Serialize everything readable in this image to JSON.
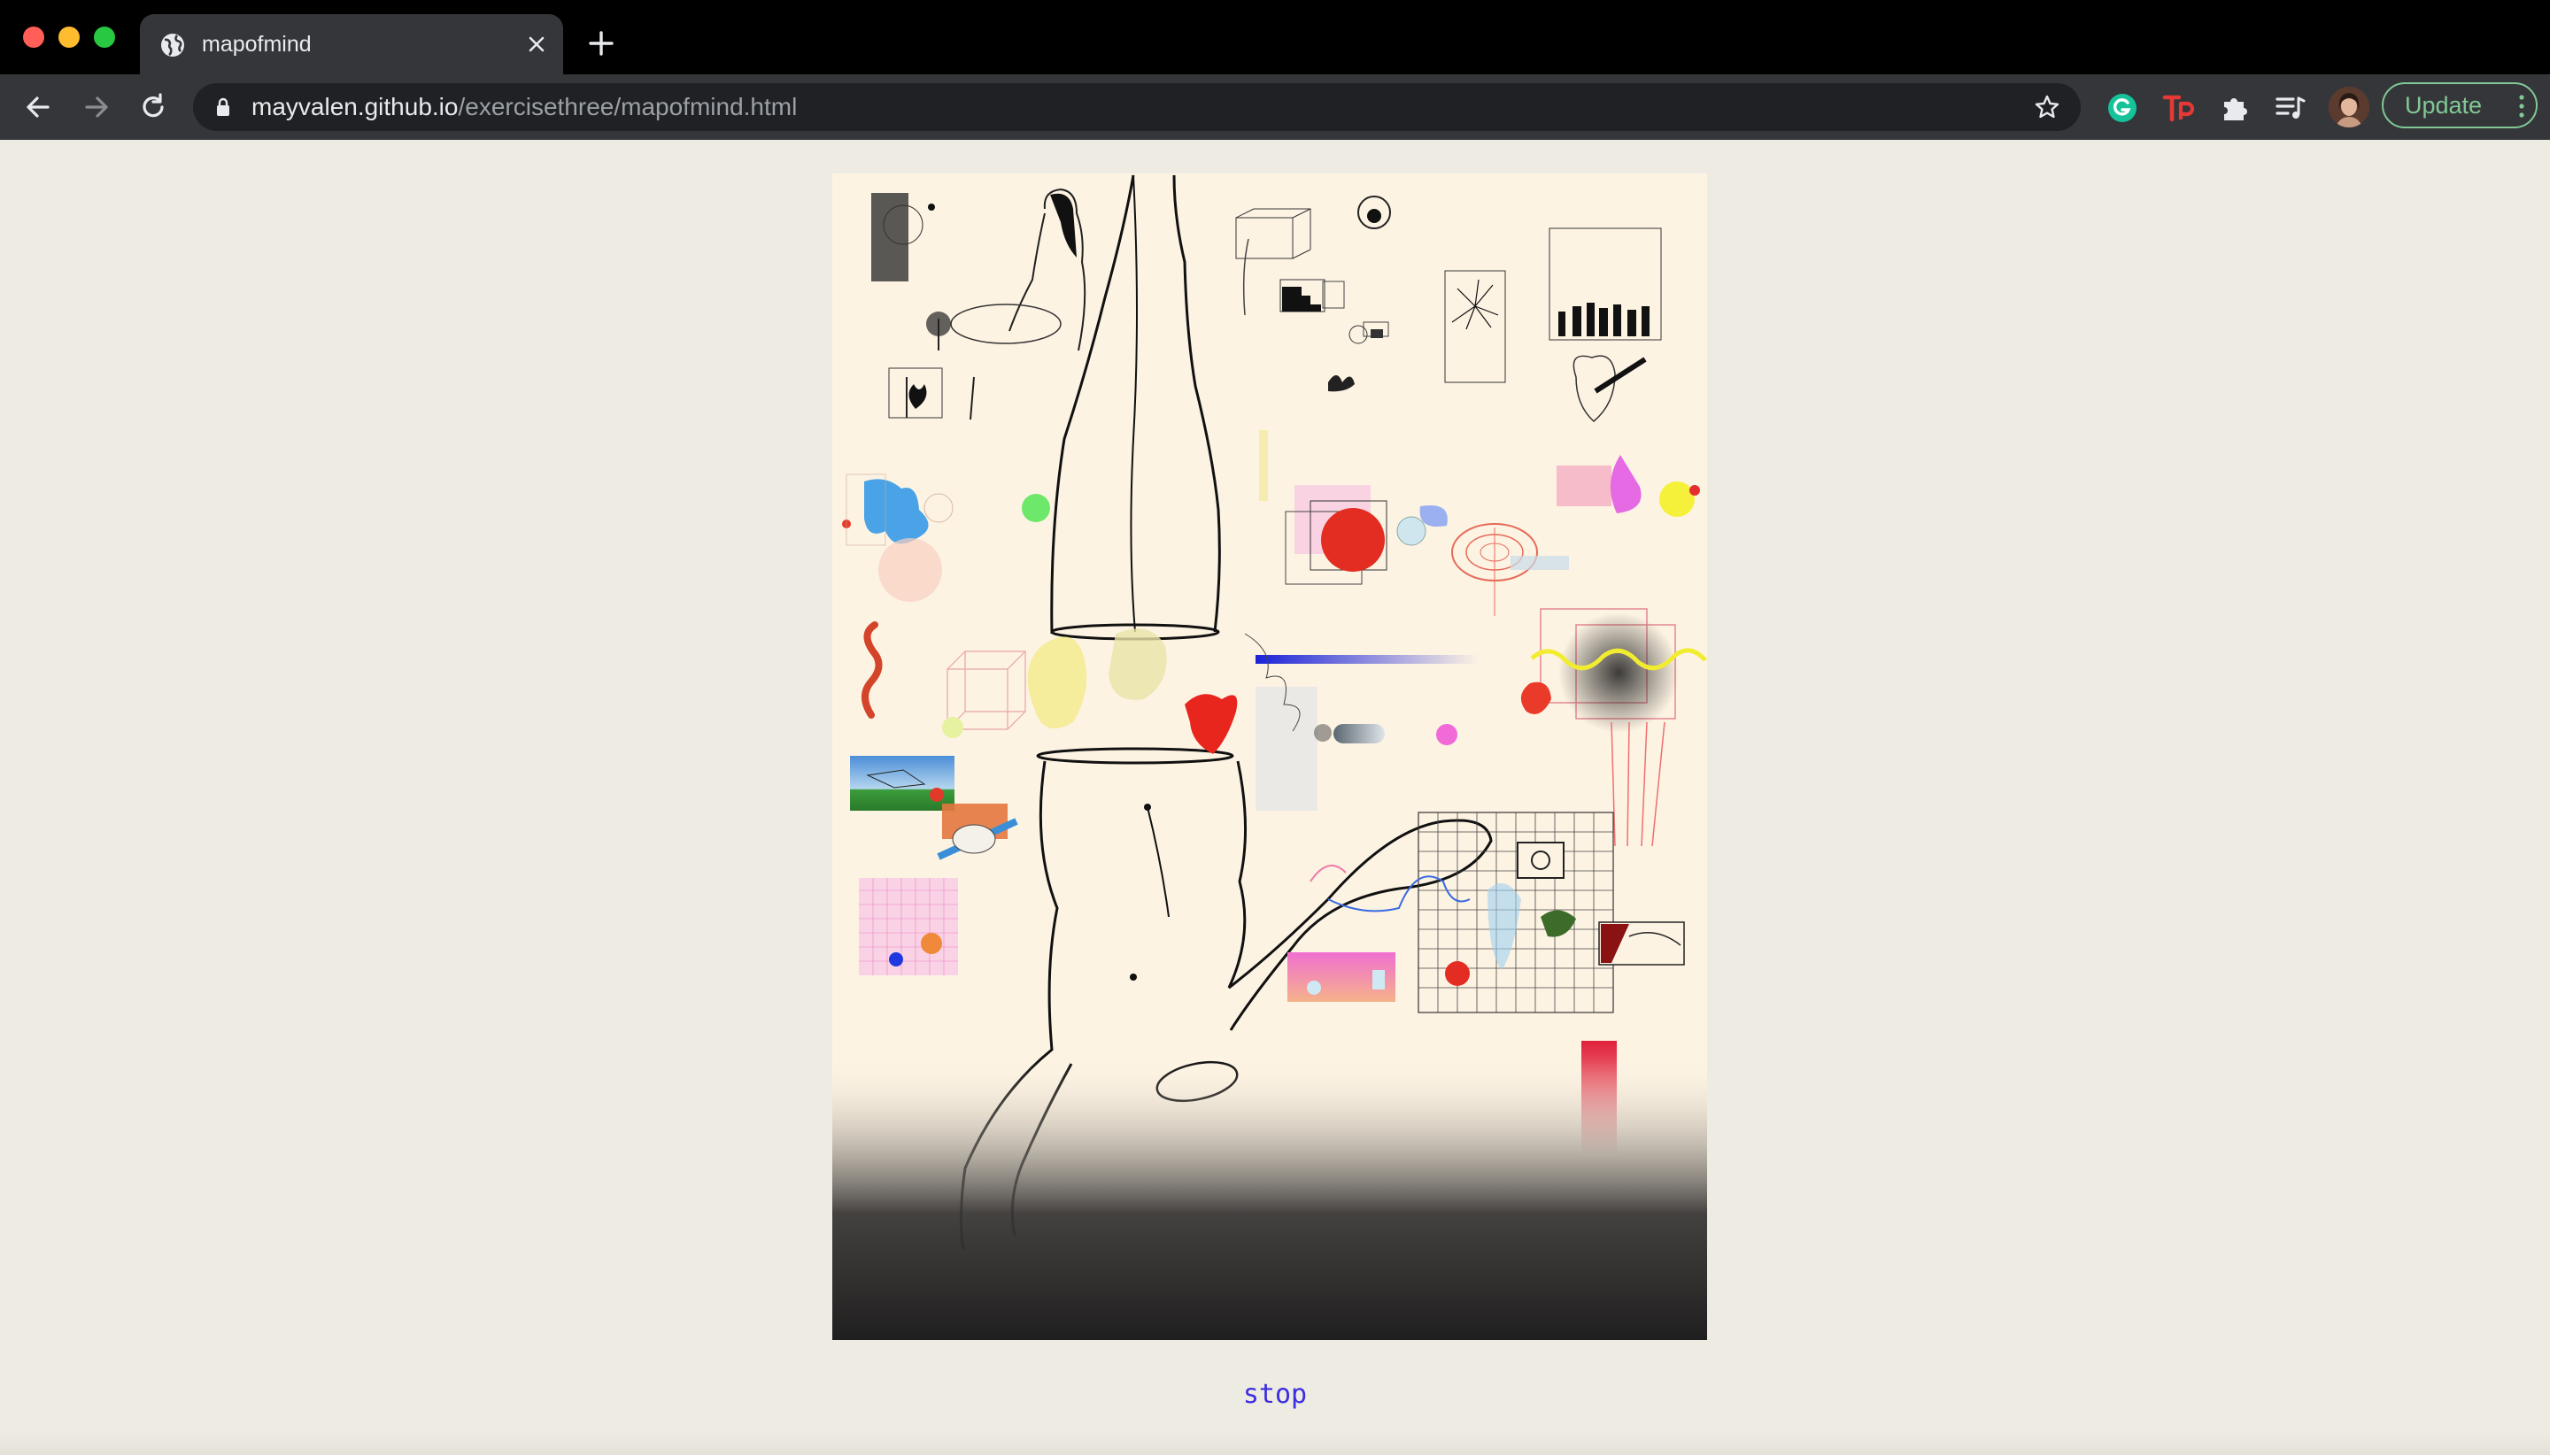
{
  "browser": {
    "tab_title": "mapofmind",
    "url_host": "mayvalen.github.io",
    "url_path": "/exercisethree/mapofmind.html",
    "update_label": "Update"
  },
  "page": {
    "stop_label": "stop"
  },
  "icons": {
    "tab_favicon": "globe-icon",
    "tab_close": "close-icon",
    "new_tab": "plus-icon",
    "back": "back-arrow-icon",
    "forward": "forward-arrow-icon",
    "reload": "reload-icon",
    "secure": "lock-icon",
    "bookmark": "star-icon",
    "grammarly": "grammarly-icon",
    "tp_extension": "tp-icon",
    "extensions": "puzzle-icon",
    "reading_list": "reading-list-icon",
    "menu": "kebab-icon"
  },
  "colors": {
    "page_background": "#eeebe3",
    "artwork_background": "#fdf3e3",
    "link": "#3a2ee0",
    "update_accent": "#81c995"
  }
}
